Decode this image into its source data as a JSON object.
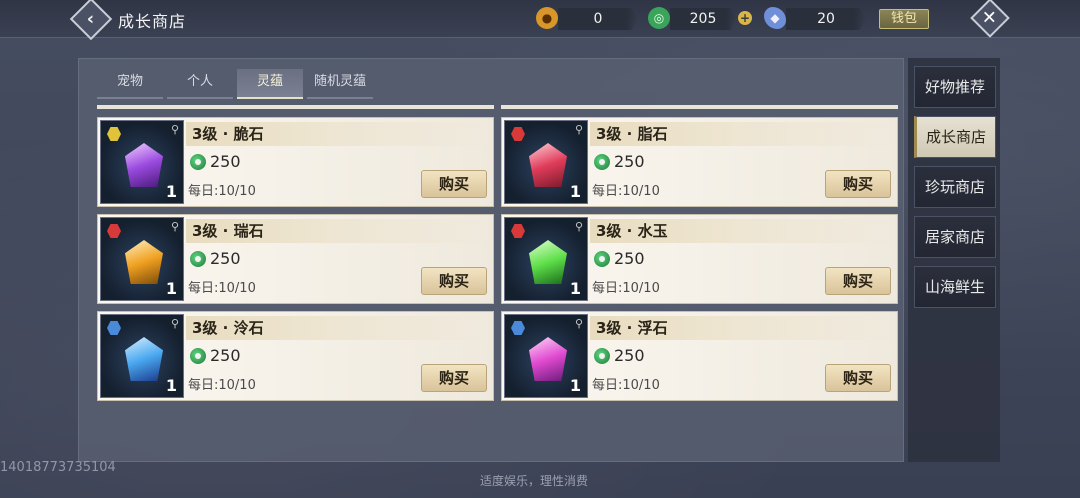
{
  "header": {
    "title": "成长商店",
    "wallet_label": "钱包",
    "currencies": [
      {
        "name": "gold-coin",
        "value": "0",
        "color": "#d9962a"
      },
      {
        "name": "jade-coin",
        "value": "205",
        "color": "#3aa55a"
      },
      {
        "name": "crystal",
        "value": "20",
        "color": "#6f8fd8"
      }
    ]
  },
  "tabs": [
    {
      "label": "宠物"
    },
    {
      "label": "个人"
    },
    {
      "label": "灵蕴"
    },
    {
      "label": "随机灵蕴"
    }
  ],
  "active_tab": "灵蕴",
  "items": [
    {
      "name": "3级 · 脆石",
      "price": "250",
      "daily": "每日:10/10",
      "qty": "1",
      "buy": "购买",
      "gem_color": "#9b4be0",
      "grade_color": "#e0c33a"
    },
    {
      "name": "3级 · 脂石",
      "price": "250",
      "daily": "每日:10/10",
      "qty": "1",
      "buy": "购买",
      "gem_color": "#e03c5a",
      "grade_color": "#d83a3a"
    },
    {
      "name": "3级 · 瑞石",
      "price": "250",
      "daily": "每日:10/10",
      "qty": "1",
      "buy": "购买",
      "gem_color": "#f0a020",
      "grade_color": "#d83a3a"
    },
    {
      "name": "3级 · 水玉",
      "price": "250",
      "daily": "每日:10/10",
      "qty": "1",
      "buy": "购买",
      "gem_color": "#5fe04a",
      "grade_color": "#d83a3a"
    },
    {
      "name": "3级 · 泠石",
      "price": "250",
      "daily": "每日:10/10",
      "qty": "1",
      "buy": "购买",
      "gem_color": "#4aa8f0",
      "grade_color": "#4a8ad8"
    },
    {
      "name": "3级 · 浮石",
      "price": "250",
      "daily": "每日:10/10",
      "qty": "1",
      "buy": "购买",
      "gem_color": "#e04ad0",
      "grade_color": "#4a8ad8"
    }
  ],
  "side_menu": [
    {
      "label": "好物推荐"
    },
    {
      "label": "成长商店"
    },
    {
      "label": "珍玩商店"
    },
    {
      "label": "居家商店"
    },
    {
      "label": "山海鲜生"
    }
  ],
  "active_side": "成长商店",
  "uid": "14018773735104",
  "footer": "适度娱乐，理性消费"
}
